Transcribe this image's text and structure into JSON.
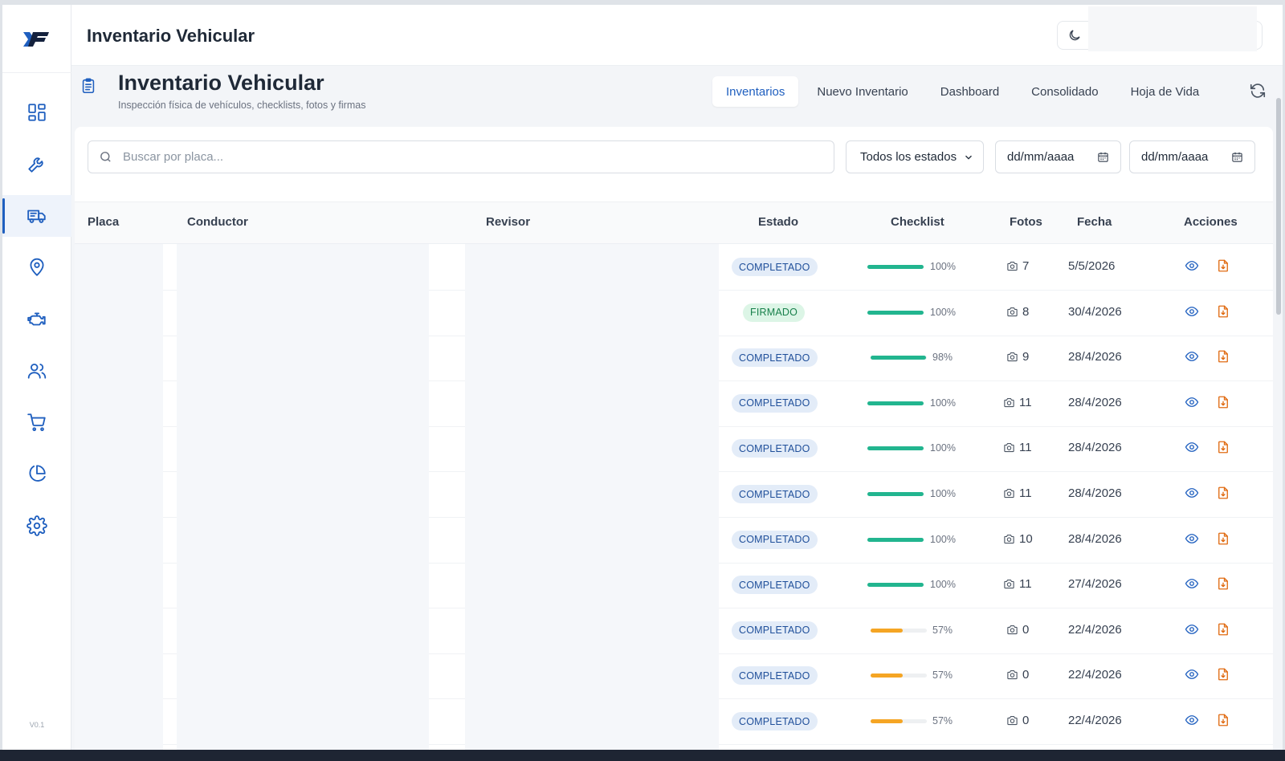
{
  "app": {
    "title": "Inventario Vehicular",
    "version": "V0.1"
  },
  "sidebar": {
    "items": [
      {
        "icon": "dashboard-icon"
      },
      {
        "icon": "wrench-icon"
      },
      {
        "icon": "truck-icon",
        "active": true
      },
      {
        "icon": "map-pin-icon"
      },
      {
        "icon": "engine-icon"
      },
      {
        "icon": "users-icon"
      },
      {
        "icon": "cart-icon"
      },
      {
        "icon": "pie-chart-icon"
      },
      {
        "icon": "settings-icon"
      }
    ]
  },
  "page": {
    "title": "Inventario Vehicular",
    "subtitle": "Inspección física de vehículos, checklists, fotos y firmas",
    "tabs": [
      {
        "label": "Inventarios",
        "active": true
      },
      {
        "label": "Nuevo Inventario"
      },
      {
        "label": "Dashboard"
      },
      {
        "label": "Consolidado"
      },
      {
        "label": "Hoja de Vida"
      }
    ]
  },
  "filters": {
    "search_placeholder": "Buscar por placa...",
    "status_select": "Todos los estados",
    "date_from": "dd/mm/aaaa",
    "date_to": "dd/mm/aaaa"
  },
  "table": {
    "columns": [
      "Placa",
      "Conductor",
      "Revisor",
      "Estado",
      "Checklist",
      "Fotos",
      "Fecha",
      "Acciones"
    ],
    "rows": [
      {
        "estado": "COMPLETADO",
        "checklist": 100,
        "checklist_label": "100%",
        "fotos": "7",
        "fecha": "5/5/2026"
      },
      {
        "estado": "FIRMADO",
        "checklist": 100,
        "checklist_label": "100%",
        "fotos": "8",
        "fecha": "30/4/2026"
      },
      {
        "estado": "COMPLETADO",
        "checklist": 98,
        "checklist_label": "98%",
        "fotos": "9",
        "fecha": "28/4/2026"
      },
      {
        "estado": "COMPLETADO",
        "checklist": 100,
        "checklist_label": "100%",
        "fotos": "11",
        "fecha": "28/4/2026"
      },
      {
        "estado": "COMPLETADO",
        "checklist": 100,
        "checklist_label": "100%",
        "fotos": "11",
        "fecha": "28/4/2026"
      },
      {
        "estado": "COMPLETADO",
        "checklist": 100,
        "checklist_label": "100%",
        "fotos": "11",
        "fecha": "28/4/2026"
      },
      {
        "estado": "COMPLETADO",
        "checklist": 100,
        "checklist_label": "100%",
        "fotos": "10",
        "fecha": "28/4/2026"
      },
      {
        "estado": "COMPLETADO",
        "checklist": 100,
        "checklist_label": "100%",
        "fotos": "11",
        "fecha": "27/4/2026"
      },
      {
        "estado": "COMPLETADO",
        "checklist": 57,
        "checklist_label": "57%",
        "fotos": "0",
        "fecha": "22/4/2026"
      },
      {
        "estado": "COMPLETADO",
        "checklist": 57,
        "checklist_label": "57%",
        "fotos": "0",
        "fecha": "22/4/2026"
      },
      {
        "estado": "COMPLETADO",
        "checklist": 57,
        "checklist_label": "57%",
        "fotos": "0",
        "fecha": "22/4/2026"
      }
    ]
  },
  "colors": {
    "accent": "#1f5fbf",
    "progress_high": "#22b58f",
    "progress_mid": "#f5a524",
    "download": "#e06b12"
  }
}
